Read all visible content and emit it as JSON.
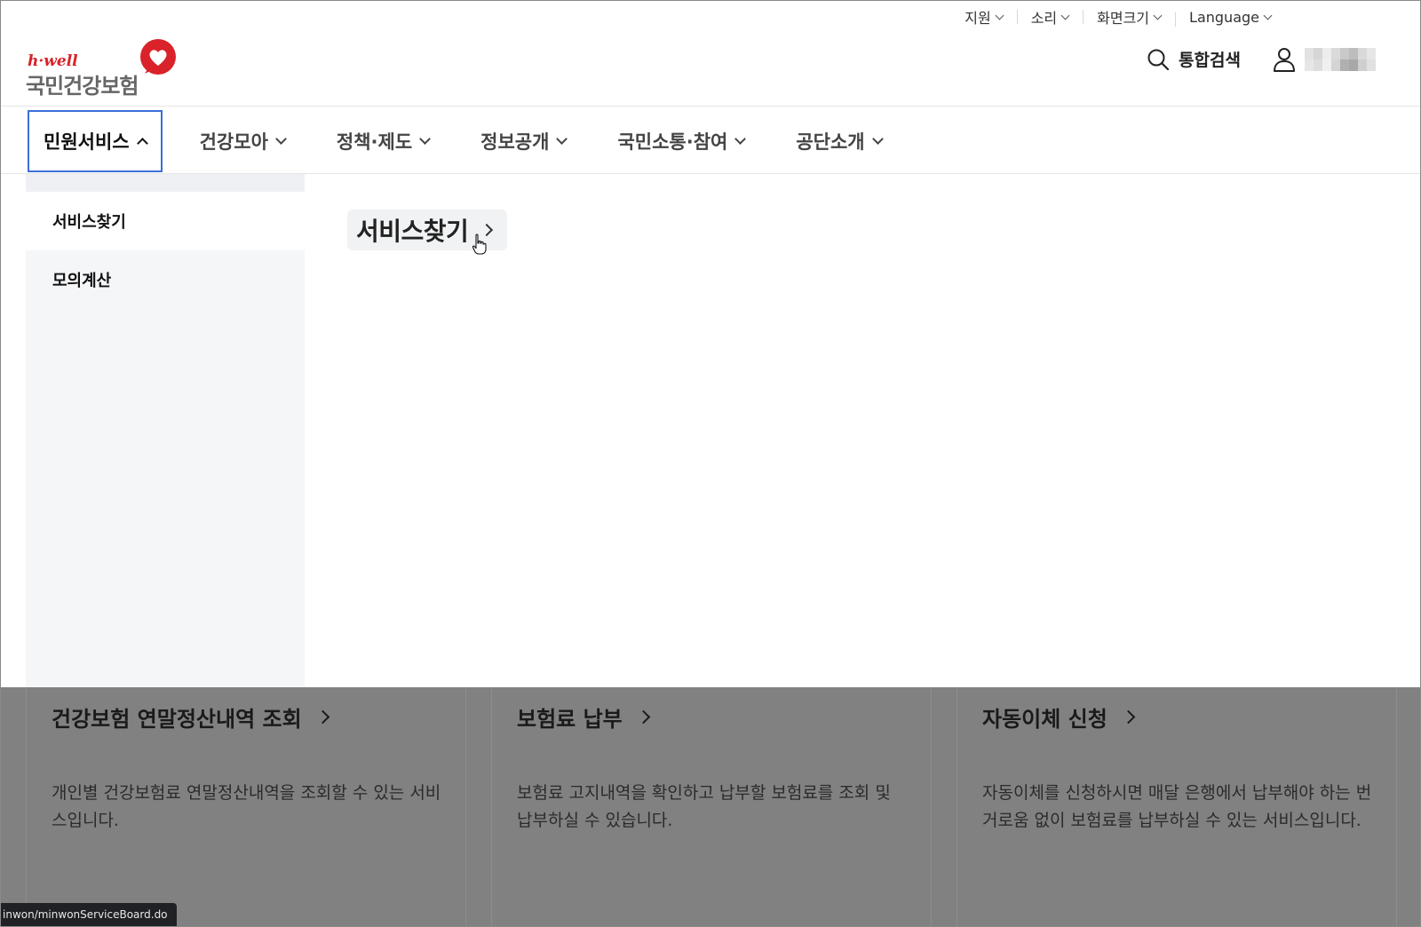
{
  "utility": {
    "items": [
      {
        "label": "지원"
      },
      {
        "label": "소리"
      },
      {
        "label": "화면크기"
      },
      {
        "label": "Language"
      }
    ]
  },
  "brand": {
    "tagline": "h·well",
    "name": "국민건강보험",
    "color": "#d9222a"
  },
  "header": {
    "search_label": "통합검색"
  },
  "gnb": {
    "items": [
      {
        "label": "민원서비스",
        "active": true
      },
      {
        "label": "건강모아"
      },
      {
        "label": "정책·제도"
      },
      {
        "label": "정보공개"
      },
      {
        "label": "국민소통·참여"
      },
      {
        "label": "공단소개"
      }
    ]
  },
  "submenu": {
    "items": [
      {
        "label": "서비스찾기",
        "active": true
      },
      {
        "label": "모의계산"
      }
    ],
    "panel_title": "서비스찾기"
  },
  "cards": [
    {
      "title": "건강보험 연말정산내역 조회",
      "desc": "개인별 건강보험료 연말정산내역을 조회할 수 있는 서비스입니다."
    },
    {
      "title": "보험료 납부",
      "desc": "보험료 고지내역을 확인하고 납부할 보험료를 조회 및 납부하실 수 있습니다."
    },
    {
      "title": "자동이체 신청",
      "desc": "자동이체를 신청하시면 매달 은행에서 납부해야 하는 번거로움 없이 보험료를 납부하실 수 있는 서비스입니다."
    }
  ],
  "status_url": "inwon/minwonServiceBoard.do"
}
